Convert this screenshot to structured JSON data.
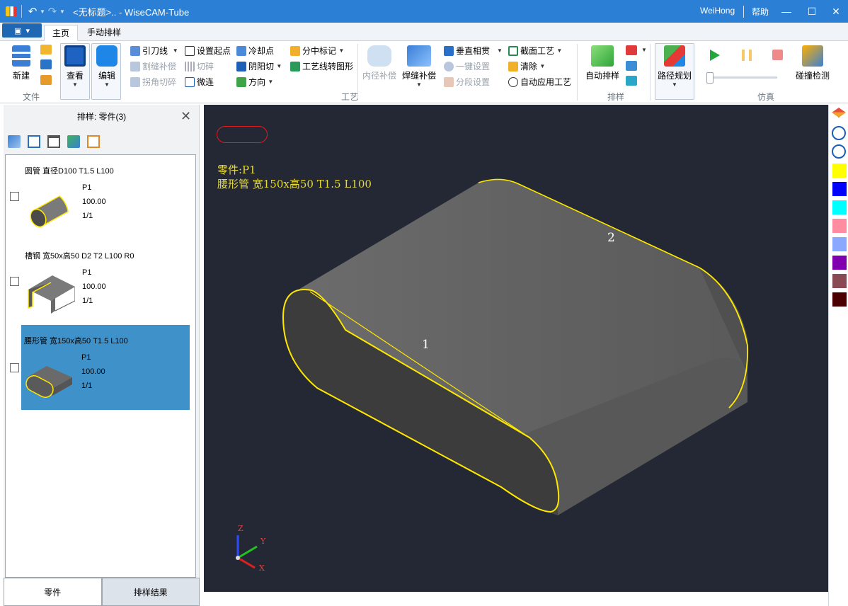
{
  "titlebar": {
    "title": "<无标题>.. - WiseCAM-Tube",
    "user": "WeiHong",
    "help": "帮助",
    "controls": [
      "minimize-icon",
      "maximize-icon",
      "close-icon"
    ]
  },
  "menu": {
    "tabs": [
      "主页",
      "手动排样"
    ],
    "active_tab": "主页"
  },
  "ribbon": {
    "file": {
      "new_label": "新建",
      "group_label": "文件"
    },
    "view_label": "查看",
    "edit_label": "编辑",
    "craft": {
      "group_label": "工艺",
      "lead_line": "引刀线",
      "set_start": "设置起点",
      "cool_point": "冷却点",
      "center_mark": "分中标记",
      "kerf_comp": "割缝补偿",
      "cut_break": "切碎",
      "yin_yang_cut": "阴阳切",
      "craft_to_shape": "工艺线转图形",
      "corner_cut": "拐角切碎",
      "micro_join": "微连",
      "direction": "方向",
      "inner_comp": "内径补偿",
      "weld_comp": "焊缝补偿",
      "vertical_pierce": "垂直相贯",
      "section_craft": "截面工艺",
      "one_key_set": "一键设置",
      "clear": "清除",
      "segment_set": "分段设置",
      "auto_apply": "自动应用工艺"
    },
    "nesting": {
      "group_label": "排样",
      "auto_nest": "自动排样"
    },
    "sim": {
      "group_label": "仿真",
      "path_plan": "路径规划",
      "collision": "碰撞检测"
    }
  },
  "left_panel": {
    "title": "排样: 零件(3)",
    "tools": [
      "edit-icon",
      "check-all-icon",
      "delete-icon",
      "copy-icon",
      "arrange-icon"
    ],
    "parts": [
      {
        "name": "圆管 直径D100 T1.5 L100",
        "id": "P1",
        "value": "100.00",
        "count": "1/1",
        "selected": false
      },
      {
        "name": "槽钢 宽50x高50 D2 T2 L100 R0",
        "id": "P1",
        "value": "100.00",
        "count": "1/1",
        "selected": false
      },
      {
        "name": "腰形管 宽150x高50 T1.5 L100",
        "id": "P1",
        "value": "100.00",
        "count": "1/1",
        "selected": true
      }
    ],
    "bottom_tabs": [
      "零件",
      "排样结果"
    ],
    "active_bottom_tab": "零件"
  },
  "viewport": {
    "info_line1": "零件:P1",
    "info_line2": "腰形管 宽150x高50 T1.5 L100",
    "label_1": "1",
    "label_2": "2",
    "axis_z": "Z",
    "axis_y": "Y",
    "axis_x": "X"
  },
  "right_strip": {
    "icons": [
      "layers-icon",
      "check-circle-icon",
      "cancel-circle-icon"
    ],
    "colors": [
      "#ffff00",
      "#0000ff",
      "#00ffff",
      "#ff8ca0",
      "#8aa8ff",
      "#8000b0",
      "#8a4a55",
      "#4a0000"
    ]
  }
}
